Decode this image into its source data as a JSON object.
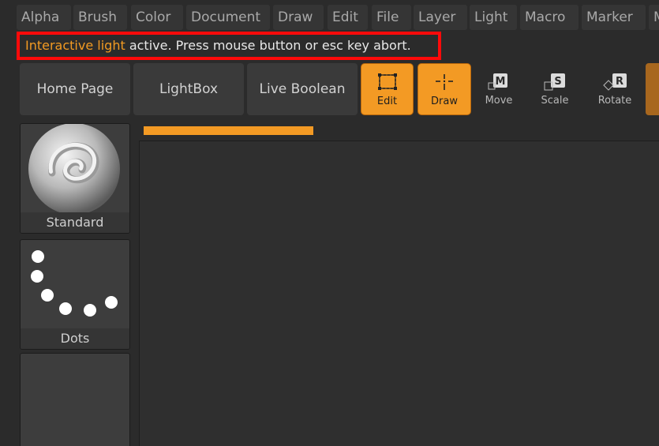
{
  "menu": {
    "items": [
      "Alpha",
      "Brush",
      "Color",
      "Document",
      "Draw",
      "Edit",
      "File",
      "Layer",
      "Light",
      "Macro",
      "Marker",
      "M"
    ]
  },
  "status": {
    "highlight": "Interactive light",
    "message": " active. Press mouse button or esc key abort."
  },
  "toolbar": {
    "home_page": "Home Page",
    "lightbox": "LightBox",
    "live_boolean": "Live Boolean",
    "edit": "Edit",
    "draw": "Draw",
    "move": "Move",
    "scale": "Scale",
    "rotate": "Rotate",
    "move_key": "M",
    "scale_key": "S",
    "rotate_key": "R"
  },
  "brushes": {
    "items": [
      "Standard",
      "Dots"
    ]
  },
  "colors": {
    "accent": "#f39a24",
    "highlight_box": "#ff0a0a"
  }
}
